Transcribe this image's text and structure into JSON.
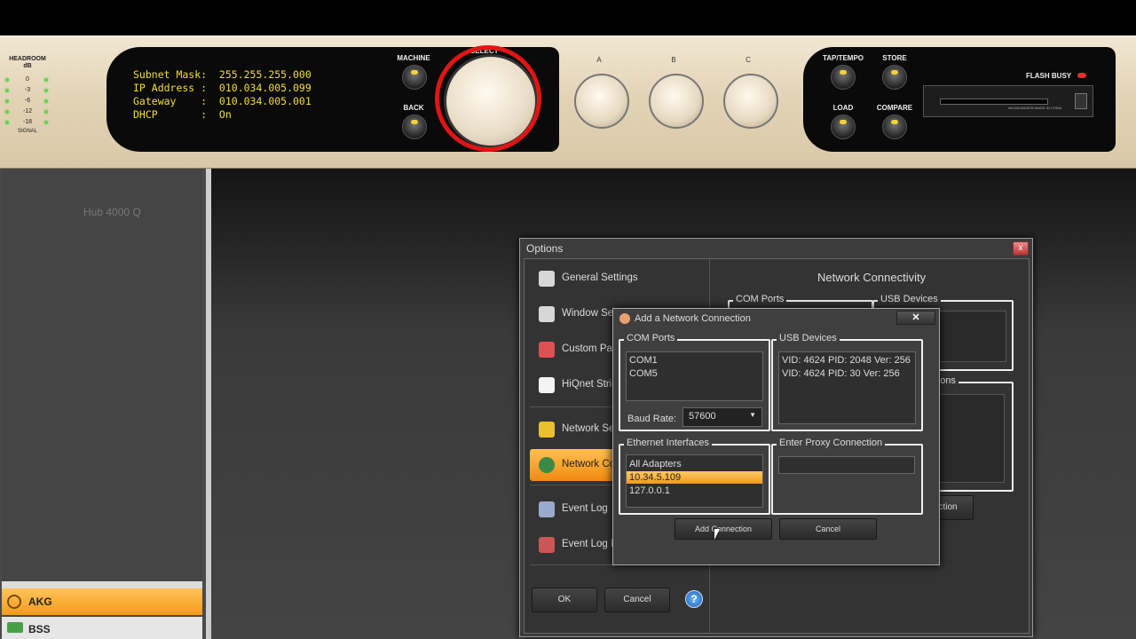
{
  "hardware": {
    "meter": {
      "title": "HEADROOM\ndB",
      "levels": [
        "0",
        "-3",
        "-6",
        "-12",
        "-18"
      ],
      "signal_label": "SIGNAL"
    },
    "lcd": {
      "line1": "Subnet Mask:  255.255.255.000",
      "line2": "IP Address :  010.034.005.099",
      "line3": "Gateway    :  010.034.005.001",
      "line4": "DHCP       :  On"
    },
    "buttons": {
      "machine": "MACHINE",
      "back": "BACK",
      "select": "SELECT",
      "tap_tempo": "TAP/TEMPO",
      "store": "STORE",
      "load": "LOAD",
      "compare": "COMPARE"
    },
    "knobs": {
      "a": "A",
      "b": "B",
      "c": "C"
    },
    "flash_busy": "FLASH BUSY",
    "card_text": "AKG81208267B   MADE IN CHINA"
  },
  "software": {
    "device_label": "Hub 4000 Q",
    "brands": [
      {
        "label": "AKG",
        "color": "#f4a52a"
      },
      {
        "label": "BSS",
        "color": "#e6e6e6"
      }
    ]
  },
  "options": {
    "title": "Options",
    "close": "x",
    "sidebar": [
      {
        "label": "General Settings"
      },
      {
        "label": "Window Settings"
      },
      {
        "label": "Custom Panel"
      },
      {
        "label": "HiQnet String"
      },
      {
        "label": "Network Settings"
      },
      {
        "label": "Network Connectivity",
        "active": true
      },
      {
        "label": "Event Log"
      },
      {
        "label": "Event Log Messages"
      }
    ],
    "right_title": "Network Connectivity",
    "bg_groups": {
      "com_ports": "COM Ports",
      "usb_devices": "USB Devices",
      "connections": "Connections"
    },
    "bg_button": "Add Connection",
    "ok": "OK",
    "cancel": "Cancel",
    "help": "?"
  },
  "add_connection": {
    "title": "Add a Network Connection",
    "close": "✕",
    "com_ports": {
      "label": "COM Ports",
      "items": [
        "COM1",
        "COM5"
      ]
    },
    "baud_rate": {
      "label": "Baud Rate:",
      "value": "57600"
    },
    "usb_devices": {
      "label": "USB Devices",
      "items": [
        "VID: 4624 PID: 2048 Ver: 256",
        "VID: 4624 PID: 30 Ver: 256"
      ]
    },
    "ethernet": {
      "label": "Ethernet Interfaces",
      "items": [
        "All Adapters",
        "10.34.5.109",
        "127.0.0.1"
      ],
      "selected_index": 1
    },
    "proxy": {
      "label": "Enter Proxy Connection",
      "value": ""
    },
    "add_button": "Add Connection",
    "cancel_button": "Cancel"
  },
  "colors": {
    "accent": "#f4a52a",
    "lcd": "#f4de2e",
    "annotation": "#e01515"
  }
}
